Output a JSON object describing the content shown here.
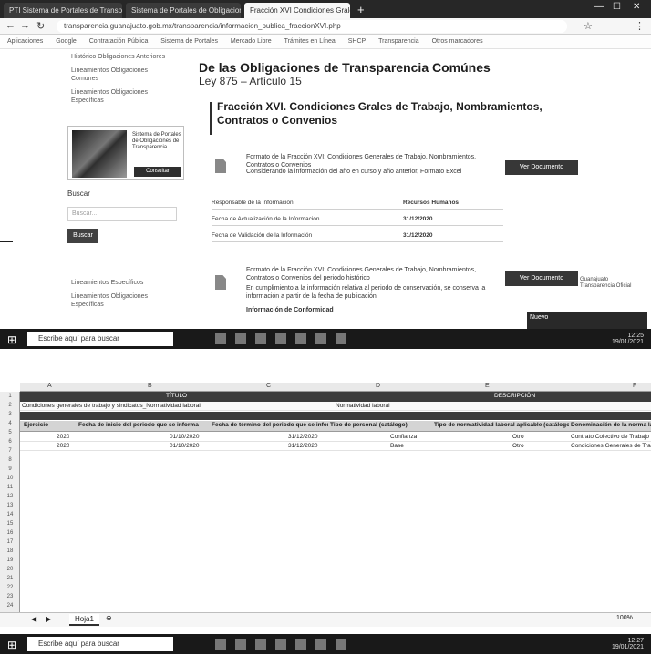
{
  "browser": {
    "tabs": [
      {
        "label": "PTI Sistema de Portales de Transparencia"
      },
      {
        "label": "Sistema de Portales de Obligaciones"
      },
      {
        "label": "Fracción XVI Condiciones Grales"
      }
    ],
    "url": "transparencia.guanajuato.gob.mx/transparencia/informacion_publica_fraccionXVI.php",
    "bookmarks": [
      "Aplicaciones",
      "Google",
      "Contratación Pública",
      "Sistema de Portales",
      "Mercado Libre",
      "Trámites en Línea",
      "SHCP",
      "Transparencia",
      "Otros marcadores"
    ]
  },
  "sidebar": {
    "links": [
      "Histórico Obligaciones Anteriores",
      "Lineamientos Obligaciones Comunes",
      "Lineamientos Obligaciones Específicas"
    ],
    "promo": {
      "text": "Sistema de Portales de Obligaciones de Transparencia",
      "button": "Consultar"
    },
    "search_label": "Buscar",
    "search_placeholder": "Buscar...",
    "search_button": "Buscar",
    "bottom_links": [
      "Lineamientos Específicos",
      "Lineamientos Obligaciones Específicas"
    ]
  },
  "main": {
    "title": "De las Obligaciones de Transparencia Comúnes",
    "subtitle": "Ley 875 – Artículo 15",
    "fraction_title": "Fracción XVI. Condiciones Grales de Trabajo, Nombramientos, Contratos o Convenios",
    "doc1": {
      "line1": "Formato de la Fracción XVI: Condiciones Generales de Trabajo, Nombramientos, Contratos o Convenios",
      "line2": "Considerando la información del año en curso y año anterior, Formato Excel",
      "button": "Ver Documento"
    },
    "info": [
      {
        "key": "Responsable de la Información",
        "value": "Recursos Humanos"
      },
      {
        "key": "Fecha de Actualización de la Información",
        "value": "31/12/2020"
      },
      {
        "key": "Fecha de Validación de la Información",
        "value": "31/12/2020"
      }
    ],
    "doc2": {
      "line1": "Formato de la Fracción XVI: Condiciones Generales de Trabajo, Nombramientos, Contratos o Convenios del periodo histórico",
      "line2": "En cumplimiento a la información relativa al periodo de conservación, se conserva la información a partir de la fecha de publicación",
      "line3": "Información de Conformidad",
      "button": "Ver Documento"
    },
    "right_note": "Guanajuato Transparencia Oficial"
  },
  "taskbar": {
    "search_placeholder": "Escribe aquí para buscar",
    "clock_time": "12:25",
    "clock_date": "19/01/2021",
    "popup_text": "Nuevo"
  },
  "sheet": {
    "col_letters": [
      "A",
      "B",
      "C",
      "D",
      "E",
      "F"
    ],
    "band1_left": "TÍTULO",
    "band1_right": "DESCRIPCIÓN",
    "row3_left": "Condiciones generales de trabajo y sindicatos_Normatividad laboral",
    "row3_right": "Normatividad laboral",
    "headers": [
      "Ejercicio",
      "Fecha de inicio del periodo que se informa",
      "Fecha de término del periodo que se informa",
      "Tipo de personal (catálogo)",
      "Tipo de normatividad laboral aplicable (catálogo)",
      "Denominación de la norma laboral aplicable"
    ],
    "rows": [
      [
        "2020",
        "01/10/2020",
        "31/12/2020",
        "Confianza",
        "Otro",
        "Contrato Colectivo de Trabajo"
      ],
      [
        "2020",
        "01/10/2020",
        "31/12/2020",
        "Base",
        "Otro",
        "Condiciones Generales de Trabajo"
      ]
    ],
    "sheet_tab": "Hoja1",
    "zoom": "100%"
  },
  "taskbar2": {
    "search_placeholder": "Escribe aquí para buscar",
    "clock_time": "12:27",
    "clock_date": "19/01/2021"
  }
}
